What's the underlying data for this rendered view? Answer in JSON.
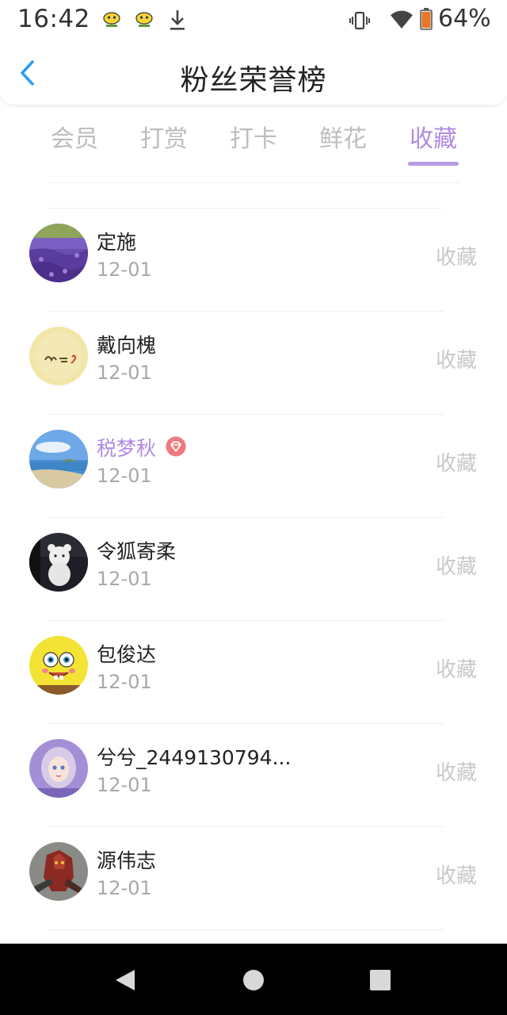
{
  "status_bar": {
    "time": "16:42",
    "battery": "64%",
    "icons": [
      "app-icon",
      "app-icon",
      "download-icon",
      "vibrate-icon",
      "wifi-icon",
      "battery-icon"
    ]
  },
  "header": {
    "title": "粉丝荣誉榜",
    "back_icon": "chevron-left-icon"
  },
  "tabs": [
    {
      "label": "会员",
      "active": false
    },
    {
      "label": "打赏",
      "active": false
    },
    {
      "label": "打卡",
      "active": false
    },
    {
      "label": "鲜花",
      "active": false
    },
    {
      "label": "收藏",
      "active": true
    }
  ],
  "fans": [
    {
      "name": "定施",
      "date": "12-01",
      "action": "收藏",
      "vip": false,
      "avatar": "lavender-field"
    },
    {
      "name": "戴向槐",
      "date": "12-01",
      "action": "收藏",
      "vip": false,
      "avatar": "handwriting"
    },
    {
      "name": "税梦秋",
      "date": "12-01",
      "action": "收藏",
      "vip": true,
      "avatar": "beach"
    },
    {
      "name": "令狐寄柔",
      "date": "12-01",
      "action": "收藏",
      "vip": false,
      "avatar": "teddy-bear"
    },
    {
      "name": "包俊达",
      "date": "12-01",
      "action": "收藏",
      "vip": false,
      "avatar": "spongebob"
    },
    {
      "name": "兮兮_2449130794...",
      "date": "12-01",
      "action": "收藏",
      "vip": false,
      "avatar": "doll-girl"
    },
    {
      "name": "源伟志",
      "date": "12-01",
      "action": "收藏",
      "vip": false,
      "avatar": "red-armor"
    }
  ],
  "colors": {
    "accent": "#b08be0",
    "inactive_tab": "#bdbdbd",
    "date_text": "#a8a8a8",
    "action_text": "#c8c8c8",
    "back_arrow": "#2a9df4",
    "vip_badge": "#f07a7a"
  },
  "nav_bar": {
    "buttons": [
      "back-triangle-icon",
      "home-circle-icon",
      "recents-square-icon"
    ]
  }
}
